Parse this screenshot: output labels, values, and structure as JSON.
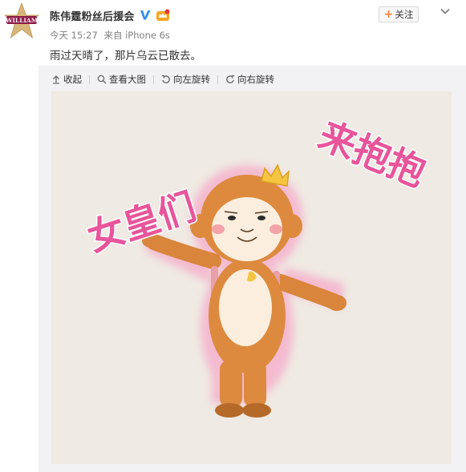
{
  "post": {
    "author": "陈伟霆粉丝后援会",
    "timestamp": "今天 15:27",
    "source": "来自 iPhone 6s",
    "text": "雨过天晴了，那片乌云已散去。",
    "follow_label": "关注",
    "follow_plus": "+",
    "avatar_text": "WILLIAM",
    "verified_icon": "verified-v-icon",
    "member_icon": "member-crown-icon"
  },
  "toolbar": {
    "collapse": "收起",
    "view_large": "查看大图",
    "rotate_left": "向左旋转",
    "rotate_right": "向右旋转"
  },
  "image": {
    "left_text": "女皇们",
    "right_text": "来抱抱",
    "text_color": "#e8559a",
    "background": "#efeae3"
  },
  "colors": {
    "accent_orange": "#ff8140",
    "verified_blue": "#2f8fe8"
  }
}
